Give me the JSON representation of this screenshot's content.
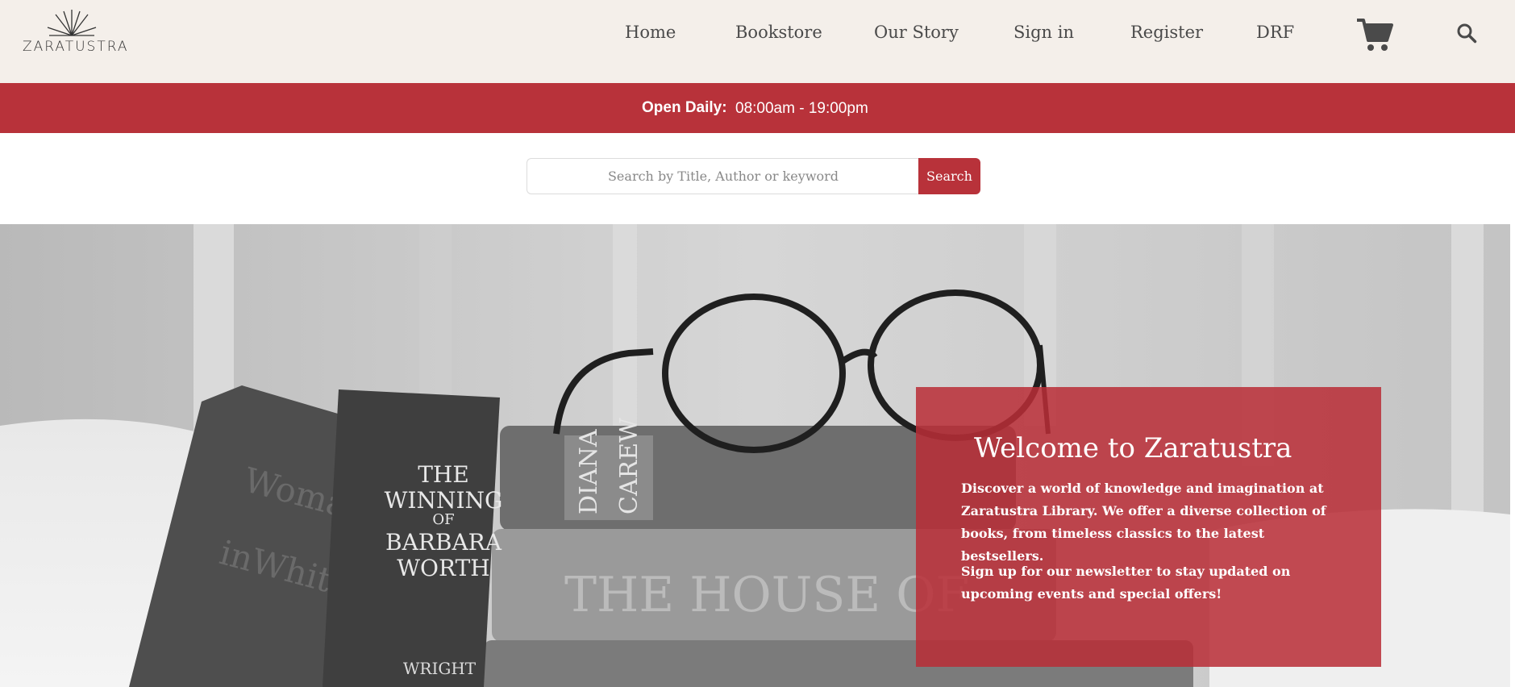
{
  "brand": {
    "name": "ZARATUSTRA",
    "logo_icon": "rising-sun-book-icon"
  },
  "nav": {
    "items": [
      {
        "label": "Home"
      },
      {
        "label": "Bookstore"
      },
      {
        "label": "Our Story"
      },
      {
        "label": "Sign in"
      },
      {
        "label": "Register"
      },
      {
        "label": "DRF"
      }
    ],
    "cart_icon": "shopping-cart-icon",
    "search_icon": "magnifier-icon"
  },
  "banner": {
    "label": "Open Daily:",
    "hours": "08:00am - 19:00pm"
  },
  "search": {
    "placeholder": "Search by Title, Author or keyword",
    "value": "",
    "button_label": "Search"
  },
  "hero": {
    "title": "Welcome to Zaratustra",
    "paragraph1": "Discover a world of knowledge and imagination at Zaratustra Library. We offer a diverse collection of books, from timeless classics to the latest bestsellers.",
    "paragraph2": "Sign up for our newsletter to stay updated on upcoming events and special offers!",
    "book_spines": [
      "Woman in White",
      "THE WINNING OF BARBARA WORTH",
      "WRIGHT",
      "DIANA CAREW"
    ]
  },
  "colors": {
    "accent": "#b8323a",
    "header_bg": "#f4efea",
    "text": "#4a4a4a"
  }
}
